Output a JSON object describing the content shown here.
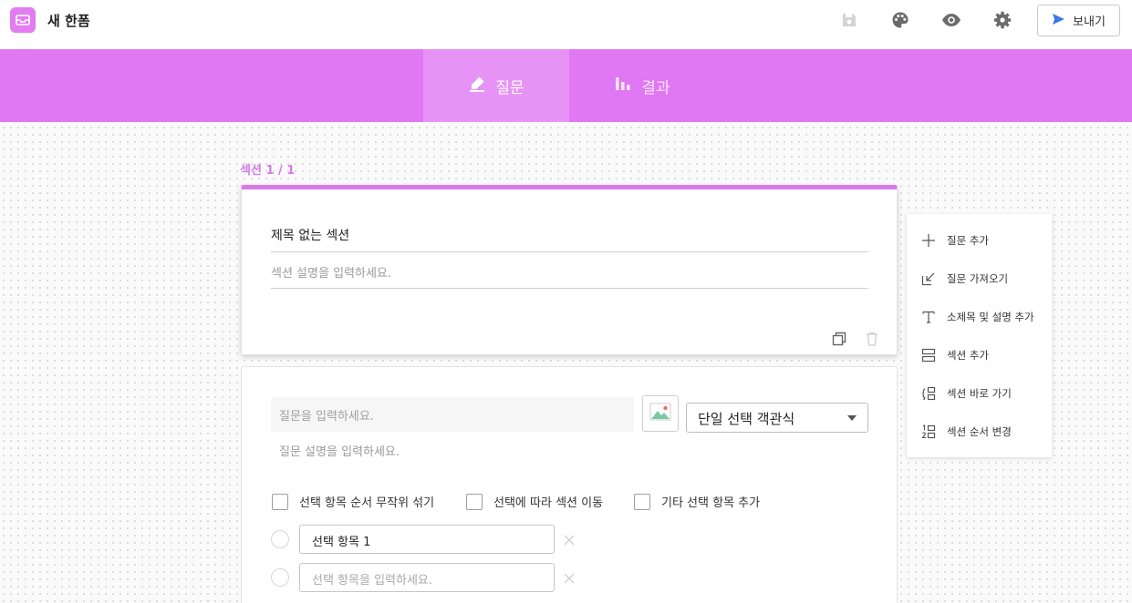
{
  "app": {
    "title": "새 한폼"
  },
  "header": {
    "send_label": "보내기",
    "icons": [
      "save-icon",
      "palette-icon",
      "eye-icon",
      "gear-icon",
      "send-icon"
    ]
  },
  "tabs": [
    {
      "label": "질문",
      "icon": "pencil-icon",
      "active": true
    },
    {
      "label": "결과",
      "icon": "bar-chart-icon",
      "active": false
    }
  ],
  "section_label": "섹션 1 / 1",
  "section_card": {
    "title": "제목 없는 섹션",
    "description_placeholder": "섹션 설명을 입력하세요."
  },
  "question_card": {
    "question_placeholder": "질문을 입력하세요.",
    "description_placeholder": "질문 설명을 입력하세요.",
    "type_selected": "단일 선택 객관식",
    "options": [
      "선택 항목 순서 무작위 섞기",
      "선택에 따라 섹션 이동",
      "기타 선택 항목 추가"
    ],
    "choices": [
      {
        "value": "선택 항목 1",
        "placeholder": ""
      },
      {
        "value": "",
        "placeholder": "선택 항목을 입력하세요."
      }
    ]
  },
  "side_menu": {
    "items": [
      {
        "label": "질문 추가",
        "icon": "plus-icon"
      },
      {
        "label": "질문 가져오기",
        "icon": "import-icon"
      },
      {
        "label": "소제목 및 설명 추가",
        "icon": "text-icon"
      },
      {
        "label": "섹션 추가",
        "icon": "section-icon"
      },
      {
        "label": "섹션 바로 가기",
        "icon": "section-jump-icon"
      },
      {
        "label": "섹션 순서 변경",
        "icon": "reorder-icon"
      }
    ]
  },
  "colors": {
    "accent": "#df78f2",
    "tab_active": "#e793f6",
    "section_label": "#d47be8"
  }
}
